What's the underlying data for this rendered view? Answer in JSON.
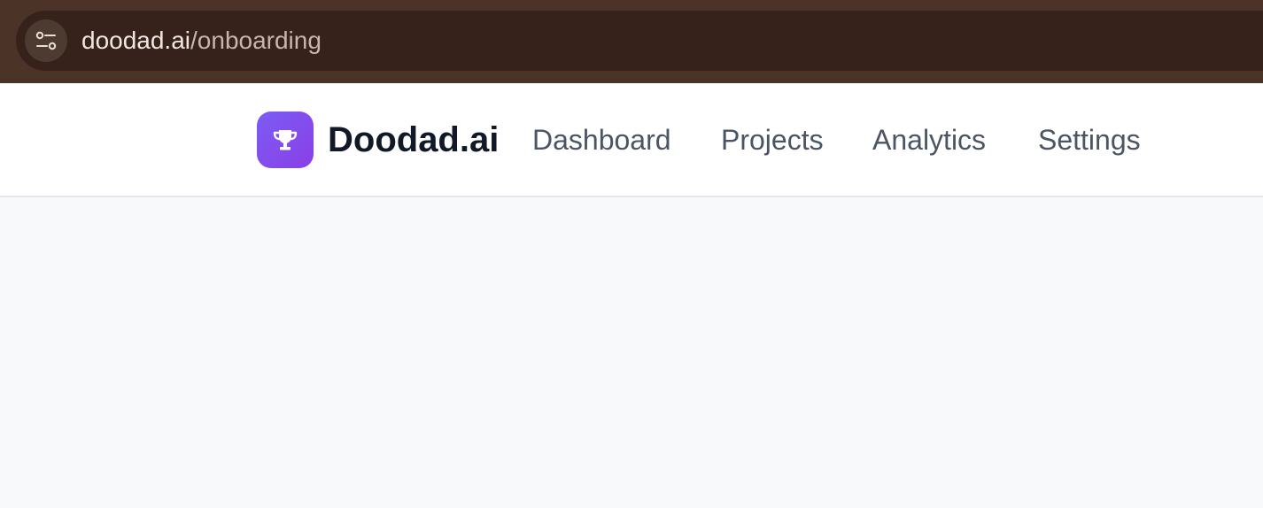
{
  "browser": {
    "url_host": "doodad.ai",
    "url_path": "/onboarding",
    "site_info_icon": "tune-icon"
  },
  "app": {
    "brand_name": "Doodad.ai",
    "logo_icon": "trophy-icon",
    "nav": {
      "dashboard": "Dashboard",
      "projects": "Projects",
      "analytics": "Analytics",
      "settings": "Settings"
    }
  },
  "colors": {
    "browser_frame": "#4c3328",
    "address_bar": "#36221a",
    "brand_gradient_start": "#7b5cf5",
    "brand_gradient_end": "#8a3fe6",
    "page_background": "#f8f9fb"
  }
}
